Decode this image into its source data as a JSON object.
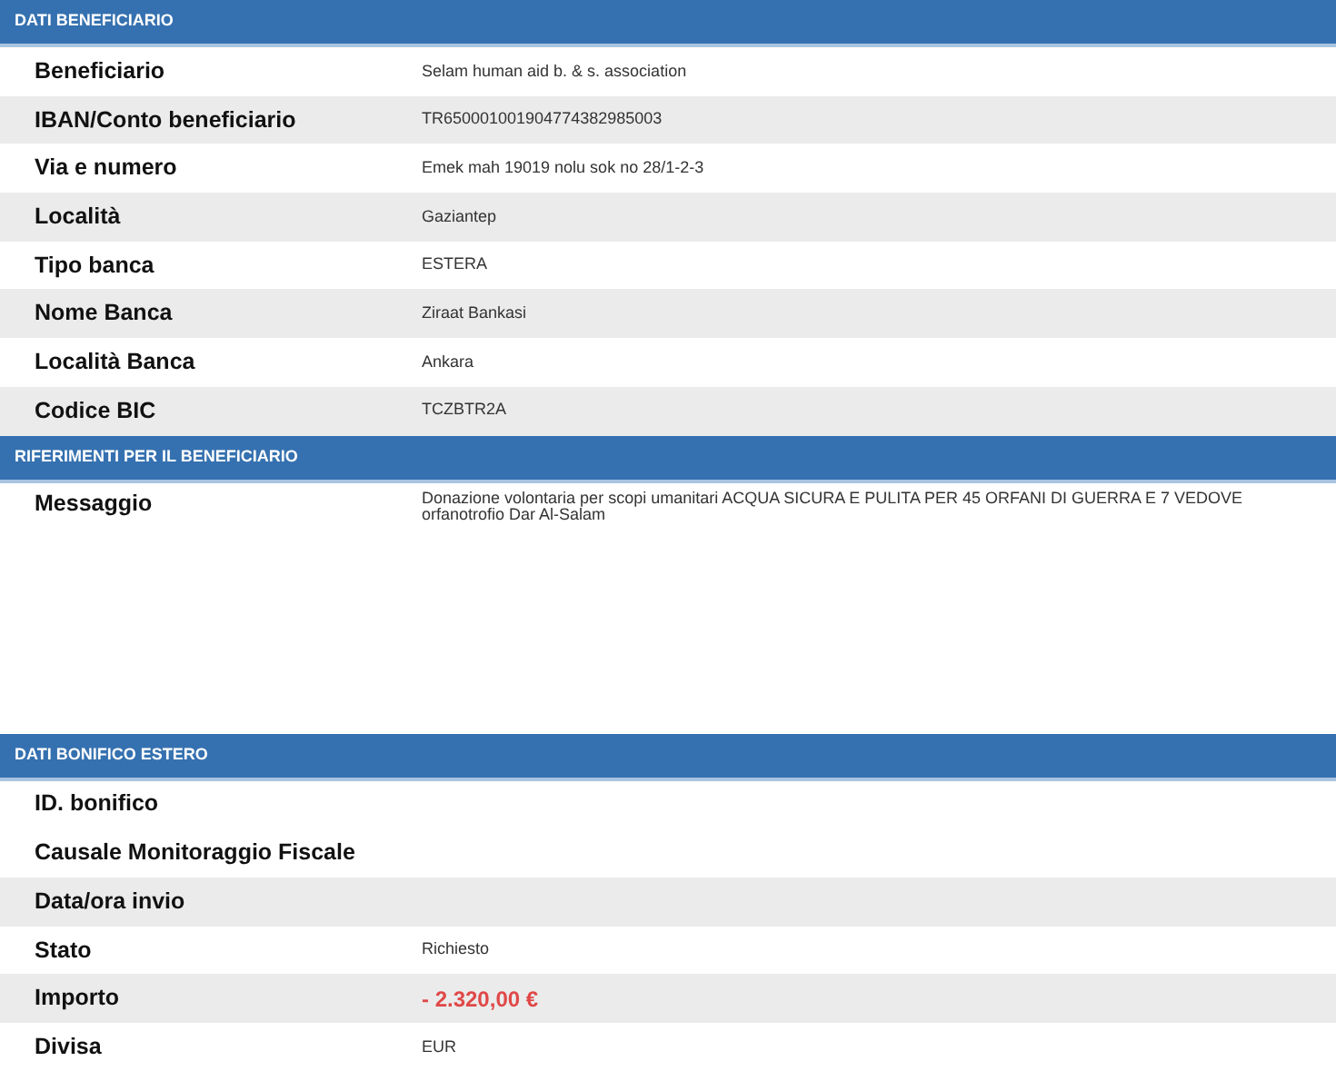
{
  "sections": [
    {
      "title": "DATI BENEFICIARIO",
      "rows": [
        {
          "label": "Beneficiario",
          "value": "Selam human aid b. & s. association",
          "shaded": false
        },
        {
          "label": "IBAN/Conto beneficiario",
          "value": "TR650001001904774382985003",
          "shaded": true
        },
        {
          "label": "Via e numero",
          "value": "Emek mah 19019 nolu sok no 28/1-2-3",
          "shaded": false
        },
        {
          "label": "Località",
          "value": "Gaziantep",
          "shaded": true
        },
        {
          "label": "Tipo banca",
          "value": "ESTERA",
          "shaded": false
        },
        {
          "label": "Nome Banca",
          "value": "Ziraat Bankasi",
          "shaded": true
        },
        {
          "label": "Località Banca",
          "value": "Ankara",
          "shaded": false
        },
        {
          "label": "Codice BIC",
          "value": "TCZBTR2A",
          "shaded": true
        }
      ]
    },
    {
      "title": "RIFERIMENTI PER IL BENEFICIARIO",
      "kind": "message",
      "rows": [
        {
          "label": "Messaggio",
          "value": "Donazione volontaria per scopi umanitari ACQUA SICURA E PULITA PER 45 ORFANI DI GUERRA E 7 VEDOVE orfanotrofio Dar Al-Salam",
          "shaded": false
        }
      ]
    },
    {
      "title": "DATI BONIFICO ESTERO",
      "rows": [
        {
          "label": "ID. bonifico",
          "shaded": false
        },
        {
          "label": "Causale Monitoraggio Fiscale",
          "shaded": false
        },
        {
          "label": "Data/ora invio",
          "shaded": true
        },
        {
          "label": "Stato",
          "value": "Richiesto",
          "shaded": false
        },
        {
          "label": "Importo",
          "value": "- 2.320,00 €",
          "kind": "amount",
          "shaded": true
        },
        {
          "label": "Divisa",
          "value": "EUR",
          "shaded": false
        }
      ]
    }
  ]
}
